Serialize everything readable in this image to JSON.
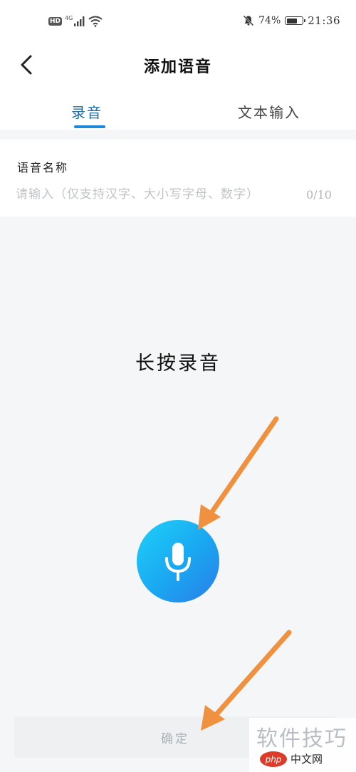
{
  "status_bar": {
    "hd_label": "HD",
    "network_label": "4G",
    "battery_percent_text": "74%",
    "battery_level": 0.74,
    "time": "21:36"
  },
  "header": {
    "title": "添加语音"
  },
  "tabs": [
    {
      "label": "录音",
      "active": true
    },
    {
      "label": "文本输入",
      "active": false
    }
  ],
  "name_field": {
    "label": "语音名称",
    "placeholder": "请输入（仅支持汉字、大小写字母、数字）",
    "value": "",
    "count": "0/10"
  },
  "record": {
    "hint": "长按录音"
  },
  "confirm": {
    "label": "确定"
  },
  "watermark": {
    "text": "软件技巧",
    "logo_text": "php 中文网"
  },
  "colors": {
    "accent": "#1c8ad6",
    "arrow": "#f0913f",
    "mic_gradient_start": "#1fd1f9",
    "mic_gradient_end": "#2b7de9"
  }
}
